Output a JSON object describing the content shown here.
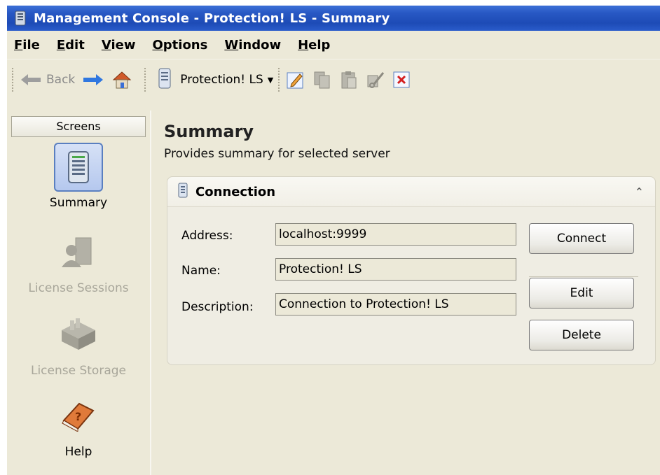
{
  "window": {
    "title": "Management Console - Protection! LS - Summary"
  },
  "menubar": {
    "items": [
      {
        "label": "File"
      },
      {
        "label": "Edit"
      },
      {
        "label": "View"
      },
      {
        "label": "Options"
      },
      {
        "label": "Window"
      },
      {
        "label": "Help"
      }
    ]
  },
  "toolbar": {
    "back_label": "Back",
    "server_label": "Protection! LS",
    "icons": [
      "back-arrow-icon",
      "forward-arrow-icon",
      "home-icon",
      "server-icon",
      "edit-icon",
      "copy-icon",
      "paste-icon",
      "cut-icon",
      "delete-icon"
    ]
  },
  "sidebar": {
    "header": "Screens",
    "items": [
      {
        "label": "Summary",
        "icon": "server-tower-icon",
        "selected": true,
        "enabled": true
      },
      {
        "label": "License Sessions",
        "icon": "users-icon",
        "selected": false,
        "enabled": false
      },
      {
        "label": "License Storage",
        "icon": "file-cabinet-icon",
        "selected": false,
        "enabled": false
      },
      {
        "label": "Help",
        "icon": "help-book-icon",
        "selected": false,
        "enabled": true
      }
    ]
  },
  "main": {
    "title": "Summary",
    "subtitle": "Provides summary for selected server",
    "panel": {
      "title": "Connection",
      "fields": {
        "address_label": "Address:",
        "address_value": "localhost:9999",
        "name_label": "Name:",
        "name_value": "Protection! LS",
        "description_label": "Description:",
        "description_value": "Connection to Protection! LS"
      },
      "buttons": {
        "connect": "Connect",
        "edit": "Edit",
        "delete": "Delete"
      }
    }
  },
  "colors": {
    "titlebar": "#2858c4",
    "background": "#ece9d8",
    "selection": "#b5c8ee"
  }
}
